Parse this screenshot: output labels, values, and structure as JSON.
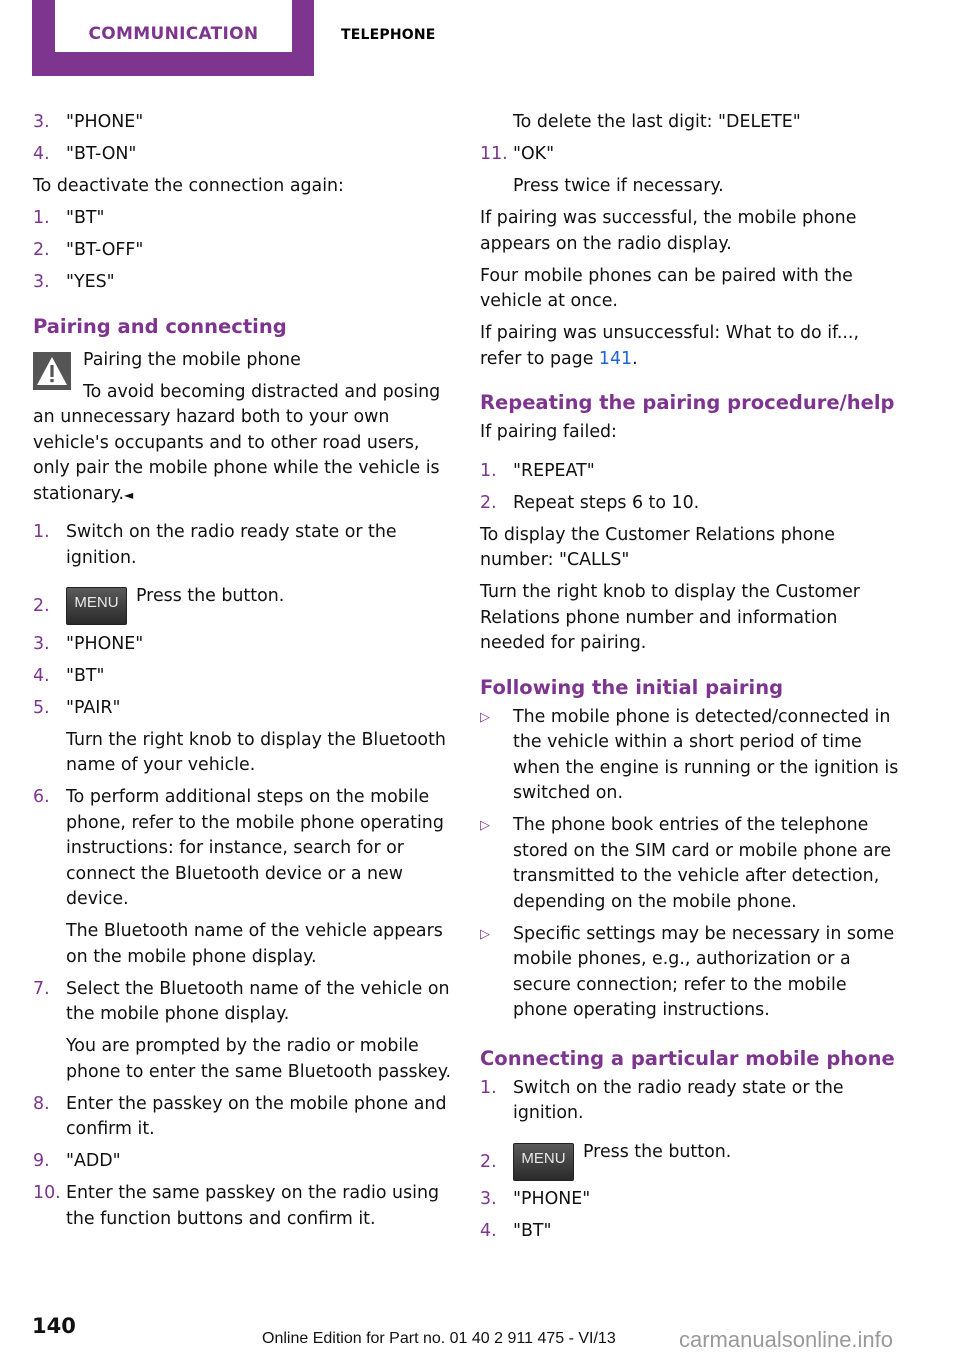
{
  "header": {
    "section_tab": "COMMUNICATION",
    "subsection": "TELEPHONE",
    "accent_color": "#7e358f"
  },
  "left": {
    "steps_a": [
      {
        "num": "3.",
        "text": "\"PHONE\""
      },
      {
        "num": "4.",
        "text": "\"BT-ON\""
      }
    ],
    "deactivate_intro": "To deactivate the connection again:",
    "steps_b": [
      {
        "num": "1.",
        "text": "\"BT\""
      },
      {
        "num": "2.",
        "text": "\"BT-OFF\""
      },
      {
        "num": "3.",
        "text": "\"YES\""
      }
    ],
    "heading": "Pairing and connecting",
    "warning": {
      "icon": "warning-triangle-icon",
      "title": "Pairing the mobile phone",
      "text": "To avoid becoming distracted and posing an unnecessary hazard both to your own vehicle's occupants and to other road users, only pair the mobile phone while the vehicle is stationary.",
      "end_mark": "◄"
    },
    "pairing_steps": [
      {
        "num": "1.",
        "text": "Switch on the radio ready state or the ignition."
      },
      {
        "num": "2.",
        "button": "MENU",
        "text": "Press the button."
      },
      {
        "num": "3.",
        "text": "\"PHONE\""
      },
      {
        "num": "4.",
        "text": "\"BT\""
      },
      {
        "num": "5.",
        "text": "\"PAIR\"",
        "sub": "Turn the right knob to display the Bluetooth name of your vehicle."
      },
      {
        "num": "6.",
        "text": "To perform additional steps on the mobile phone, refer to the mobile phone operating instructions: for instance, search for or connect the Bluetooth device or a new device.",
        "sub": "The Bluetooth name of the vehicle appears on the mobile phone display."
      },
      {
        "num": "7.",
        "text": "Select the Bluetooth name of the vehicle on the mobile phone display.",
        "sub": "You are prompted by the radio or mobile phone to enter the same Bluetooth passkey."
      },
      {
        "num": "8.",
        "text": "Enter the passkey on the mobile phone and confirm it."
      },
      {
        "num": "9.",
        "text": "\"ADD\""
      },
      {
        "num": "10.",
        "text": "Enter the same passkey on the radio using the function buttons and confirm it."
      }
    ]
  },
  "right": {
    "delete_hint": "To delete the last digit: \"DELETE\"",
    "step11": {
      "num": "11.",
      "text": "\"OK\"",
      "sub": "Press twice if necessary."
    },
    "success_text": "If pairing was successful, the mobile phone appears on the radio display.",
    "four_phones_text": "Four mobile phones can be paired with the vehicle at once.",
    "unsuccessful_prefix": "If pairing was unsuccessful: What to do if..., refer to page ",
    "unsuccessful_link": "141",
    "unsuccessful_suffix": ".",
    "repeat_heading": "Repeating the pairing procedure/help",
    "repeat_intro": "If pairing failed:",
    "repeat_steps": [
      {
        "num": "1.",
        "text": "\"REPEAT\""
      },
      {
        "num": "2.",
        "text": "Repeat steps 6 to 10."
      }
    ],
    "calls_text": "To display the Customer Relations phone number: \"CALLS\"",
    "knob_text": "Turn the right knob to display the Customer Relations phone number and information needed for pairing.",
    "following_heading": "Following the initial pairing",
    "bullet_mark": "▷",
    "bullets": [
      "The mobile phone is detected/connected in the vehicle within a short period of time when the engine is running or the ignition is switched on.",
      "The phone book entries of the telephone stored on the SIM card or mobile phone are transmitted to the vehicle after detection, depending on the mobile phone.",
      "Specific settings may be necessary in some mobile phones, e.g., authorization or a secure connection; refer to the mobile phone operating instructions."
    ],
    "connect_heading": "Connecting a particular mobile phone",
    "connect_steps": [
      {
        "num": "1.",
        "text": "Switch on the radio ready state or the ignition."
      },
      {
        "num": "2.",
        "button": "MENU",
        "text": "Press the button."
      },
      {
        "num": "3.",
        "text": "\"PHONE\""
      },
      {
        "num": "4.",
        "text": "\"BT\""
      }
    ]
  },
  "footer": {
    "page_number": "140",
    "edition": "Online Edition for Part no. 01 40 2 911 475 - VI/13",
    "watermark": "carmanualsonline.info"
  }
}
